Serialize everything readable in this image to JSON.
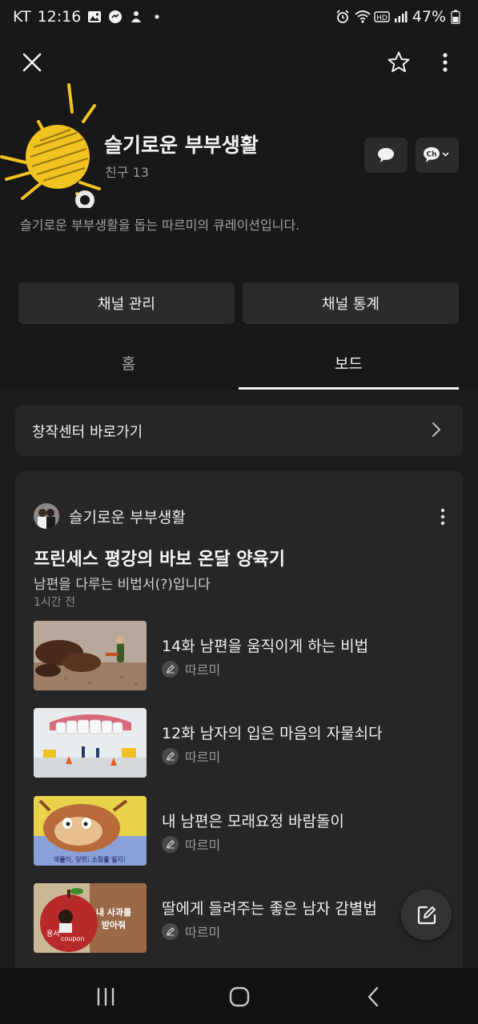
{
  "status_bar": {
    "carrier": "KT",
    "time": "12:16",
    "battery": "47%",
    "icons_left": [
      "gallery-icon",
      "messenger-icon",
      "bot-icon",
      "dot-icon"
    ],
    "icons_right": [
      "alarm-icon",
      "wifi-icon",
      "hd-icon",
      "signal-icon",
      "battery-icon"
    ]
  },
  "header": {
    "close_icon": "close-icon",
    "favorite_icon": "star-icon",
    "more_icon": "more-vertical-icon"
  },
  "channel": {
    "name": "슬기로운 부부생활",
    "friends": "친구 13",
    "description": "슬기로운 부부생활을 돕는 따르미의 큐레이션입니다.",
    "chat_icon": "chat-bubble-icon",
    "channel_menu_icon": "channel-dropdown-icon",
    "channel_menu_label": "Ch"
  },
  "actions": {
    "manage_label": "채널 관리",
    "stats_label": "채널 통계"
  },
  "tabs": [
    {
      "label": "홈",
      "active": false
    },
    {
      "label": "보드",
      "active": true
    }
  ],
  "creator_center": {
    "label": "창작센터 바로가기"
  },
  "post": {
    "author": "슬기로운 부부생활",
    "title": "프린세스 평강의 바보 온달 양육기",
    "subtitle": "남편을 다루는 비법서(?)입니다",
    "time": "1시간 전",
    "items": [
      {
        "title": "14화 남편을 움직이게 하는 비법",
        "author": "따르미"
      },
      {
        "title": "12화 남자의 입은 마음의 자물쇠다",
        "author": "따르미"
      },
      {
        "title": "내 남편은 모래요정 바람돌이",
        "author": "따르미"
      },
      {
        "title": "딸에게 들려주는 좋은 남자 감별법",
        "author": "따르미"
      }
    ],
    "thumb_texts": {
      "item3": "애들아, 당연! 소원을 빌지!",
      "item4_line1": "내 사과를",
      "item4_line2": "받아줘",
      "item4_brand": "coupon",
      "item4_small": "용서"
    }
  },
  "fab": {
    "icon": "edit-icon"
  },
  "system_nav": {
    "recent_icon": "recent-apps-icon",
    "home_icon": "home-icon",
    "back_icon": "back-icon"
  },
  "colors": {
    "background": "#1c1c1c",
    "header_bg": "#181818",
    "card_bg": "#262626",
    "button_bg": "#2b2b2b",
    "text_primary": "#f0f0f0",
    "text_secondary": "#9a9a9a",
    "sun_yellow": "#f2c320"
  }
}
